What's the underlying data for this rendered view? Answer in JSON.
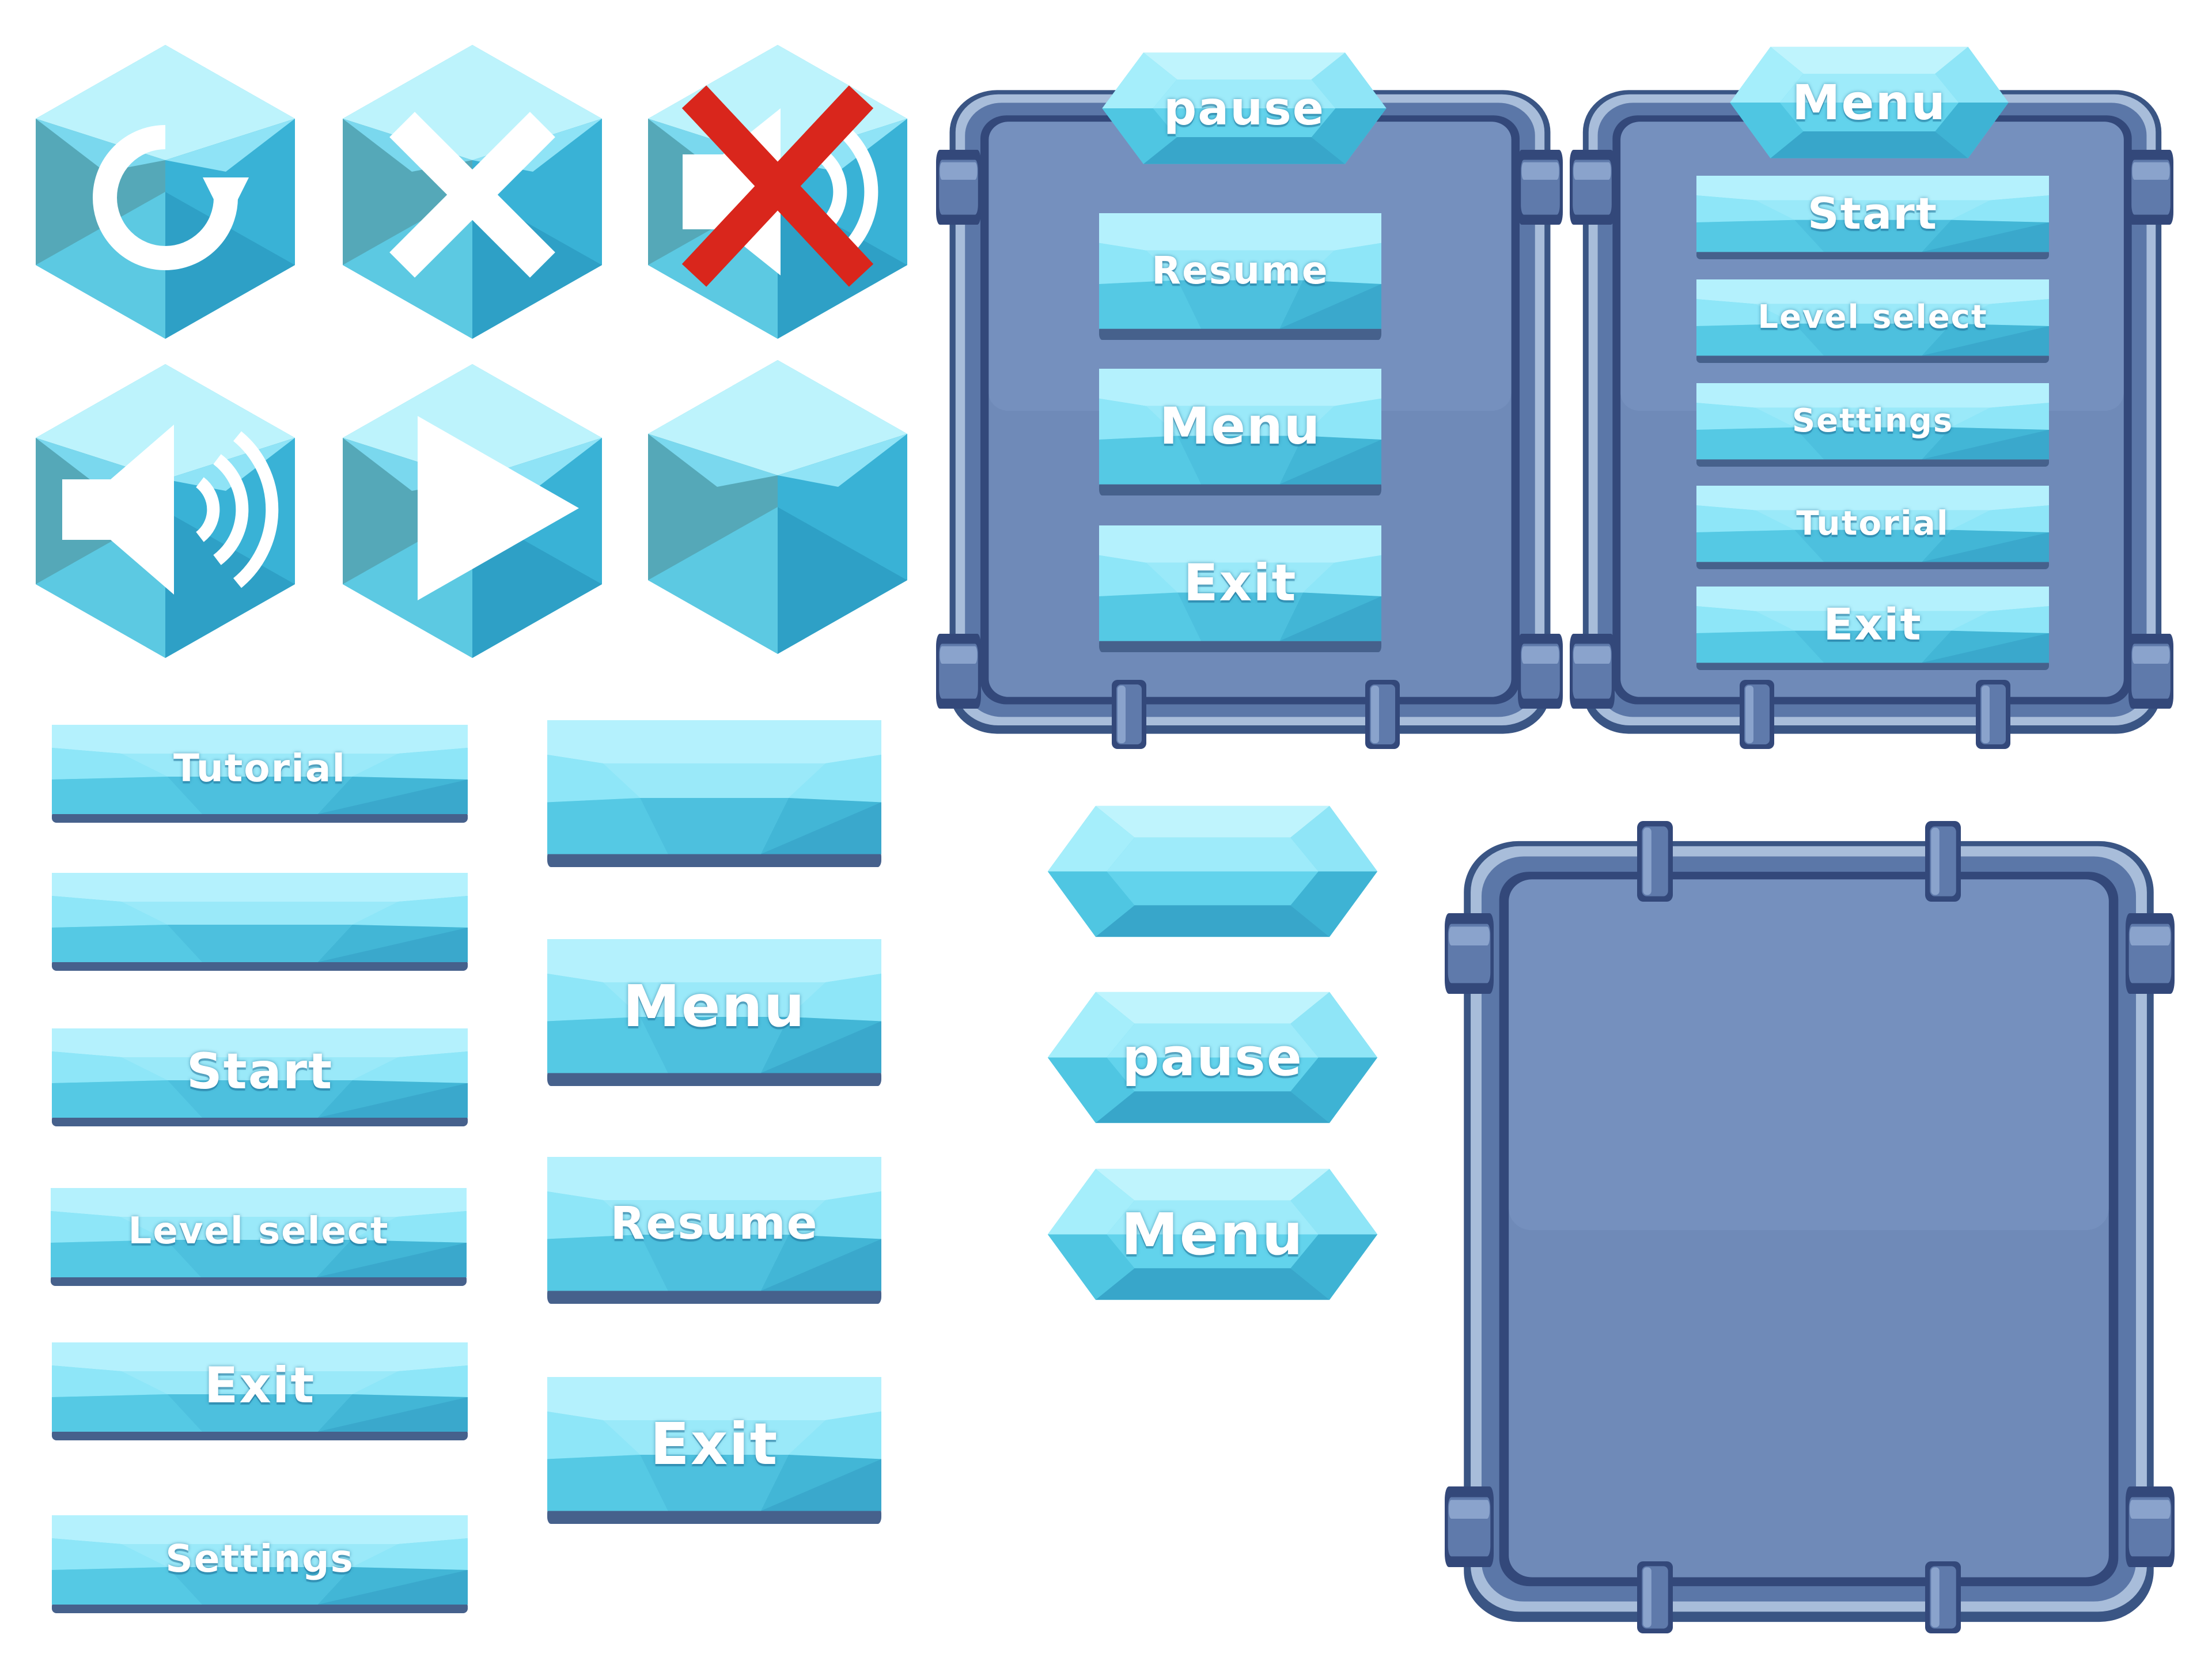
{
  "icons": [
    {
      "name": "restart-icon"
    },
    {
      "name": "close-icon"
    },
    {
      "name": "sound-muted-icon"
    },
    {
      "name": "sound-on-icon"
    },
    {
      "name": "play-icon"
    },
    {
      "name": "blank-hex-icon"
    }
  ],
  "buttons_left": {
    "tutorial": "Tutorial",
    "blank": "",
    "start": "Start",
    "level_select": "Level select",
    "exit": "Exit",
    "settings": "Settings"
  },
  "buttons_mid": {
    "blank": "",
    "menu": "Menu",
    "resume": "Resume",
    "exit": "Exit"
  },
  "hex_buttons": {
    "blank": "",
    "pause": "pause",
    "menu": "Menu"
  },
  "pause_panel": {
    "title": "pause",
    "items": [
      "Resume",
      "Menu",
      "Exit"
    ]
  },
  "menu_panel": {
    "title": "Menu",
    "items": [
      "Start",
      "Level select",
      "Settings",
      "Tutorial",
      "Exit"
    ]
  },
  "colors": {
    "crystal_light": "#9deefc",
    "crystal_mid": "#58cde6",
    "crystal_dark": "#2fa3c4",
    "button_shadow": "#46618c",
    "frame_outer": "#3f5a89",
    "frame_inner": "#6b86b3",
    "red_x": "#d9261c"
  }
}
